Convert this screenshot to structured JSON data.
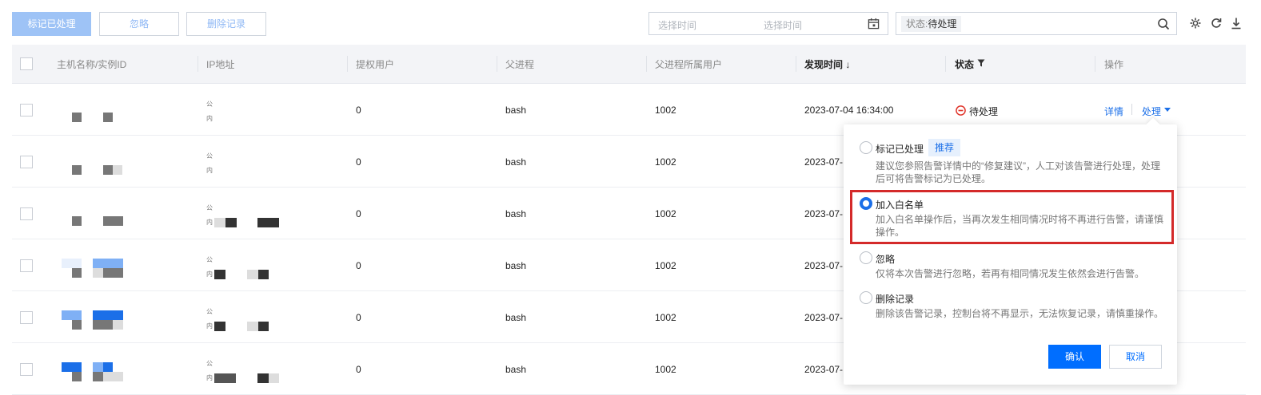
{
  "toolbar": {
    "mark_handled": "标记已处理",
    "ignore": "忽略",
    "delete_record": "删除记录",
    "date_start_placeholder": "选择时间",
    "date_end_placeholder": "选择时间",
    "filter_key": "状态:",
    "filter_value": "待处理"
  },
  "table": {
    "columns": [
      "主机名称/实例ID",
      "IP地址",
      "提权用户",
      "父进程",
      "父进程所属用户",
      "发现时间 ↓",
      "状态",
      "操作"
    ],
    "ip_public_label": "公",
    "ip_private_label": "内",
    "rows": [
      {
        "priv_user": "0",
        "parent_proc": "bash",
        "parent_user": "1002",
        "time": "2023-07-04 16:34:00",
        "status": "待处理",
        "detail": "详情",
        "handle": "处理"
      },
      {
        "priv_user": "0",
        "parent_proc": "bash",
        "parent_user": "1002",
        "time": "2023-07-"
      },
      {
        "priv_user": "0",
        "parent_proc": "bash",
        "parent_user": "1002",
        "time": "2023-07-"
      },
      {
        "priv_user": "0",
        "parent_proc": "bash",
        "parent_user": "1002",
        "time": "2023-07-"
      },
      {
        "priv_user": "0",
        "parent_proc": "bash",
        "parent_user": "1002",
        "time": "2023-07-"
      },
      {
        "priv_user": "0",
        "parent_proc": "bash",
        "parent_user": "1002",
        "time": "2023-07-"
      }
    ]
  },
  "popover": {
    "options": [
      {
        "title": "标记已处理",
        "badge": "推荐",
        "desc": "建议您参照告警详情中的“修复建议”，人工对该告警进行处理，处理后可将告警标记为已处理。",
        "checked": false
      },
      {
        "title": "加入白名单",
        "desc": "加入白名单操作后，当再次发生相同情况时将不再进行告警，请谨慎操作。",
        "checked": true
      },
      {
        "title": "忽略",
        "desc": "仅将本次告警进行忽略，若再有相同情况发生依然会进行告警。",
        "checked": false
      },
      {
        "title": "删除记录",
        "desc": "删除该告警记录，控制台将不再显示，无法恢复记录，请慎重操作。",
        "checked": false
      }
    ],
    "confirm": "确认",
    "cancel": "取消"
  },
  "colors": {
    "primary": "#006eff",
    "primary_disabled": "#9ec3f6",
    "status_red": "#e0362c",
    "highlight": "#d42a2a"
  }
}
